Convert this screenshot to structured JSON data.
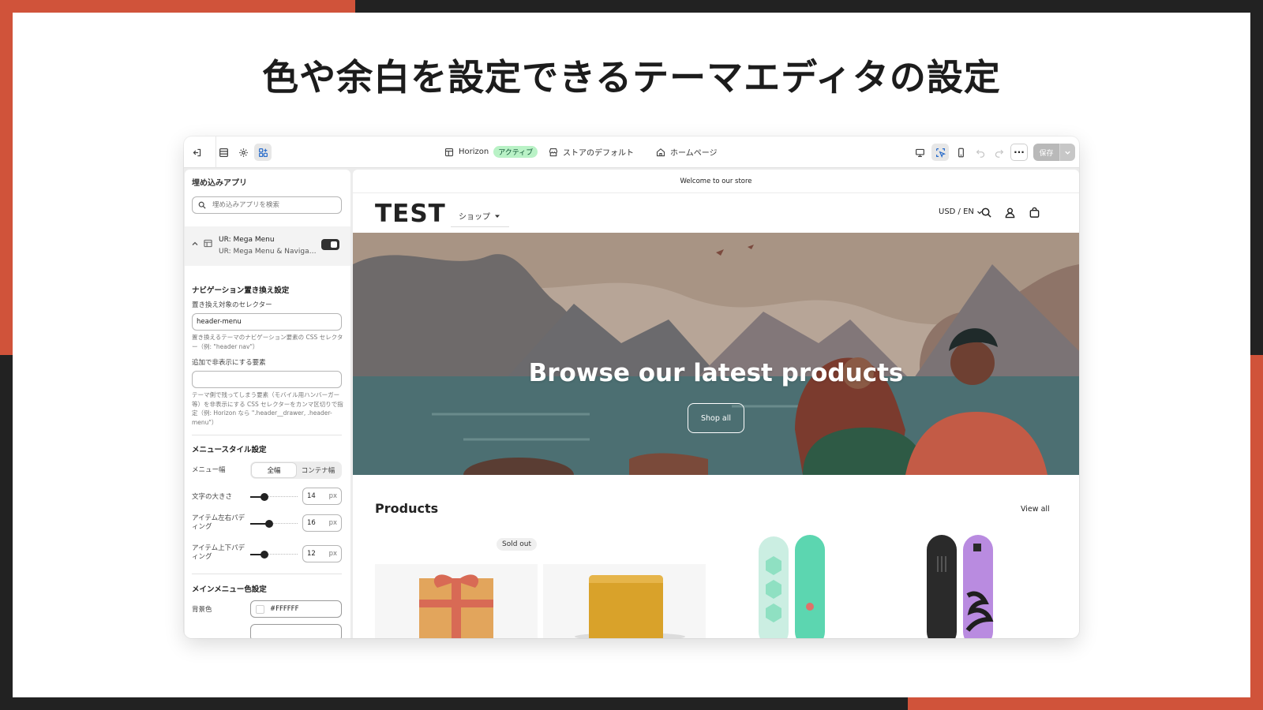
{
  "slide": {
    "headline": "色や余白を設定できるテーマエディタの設定"
  },
  "topbar": {
    "theme_name": "Horizon",
    "theme_badge": "アクティブ",
    "store_default": "ストアのデフォルト",
    "page": "ホームページ",
    "save_label": "保存",
    "icons": [
      "exit-icon",
      "sections-icon",
      "settings-icon",
      "apps-icon",
      "desktop-preview-icon",
      "inspector-icon",
      "mobile-preview-icon",
      "undo-icon",
      "redo-icon",
      "more-icon"
    ]
  },
  "sidebar": {
    "title": "埋め込みアプリ",
    "search_placeholder": "埋め込みアプリを検索",
    "app": {
      "name": "UR: Mega Menu",
      "subtitle": "UR: Mega Menu & Navigat...",
      "enabled": true
    },
    "nav_section": {
      "title": "ナビゲーション置き換え設定",
      "selector_label": "置き換え対象のセレクター",
      "selector_value": "header-menu",
      "selector_help": "置き換えるテーマのナビゲーション要素の CSS セレクター（例: \"header nav\"）",
      "hide_label": "追加で非表示にする要素",
      "hide_value": "",
      "hide_help": "テーマ側で残ってしまう要素（モバイル用ハンバーガー等）を非表示にする CSS セレクターをカンマ区切りで指定（例: Horizon なら \".header__drawer, .header-menu\"）"
    },
    "style_section": {
      "title": "メニュースタイル設定",
      "width_label": "メニュー幅",
      "width_options": [
        "全幅",
        "コンテナ幅"
      ],
      "width_selected": "全幅",
      "font_size_label": "文字の大きさ",
      "font_size_value": "14",
      "font_size_fraction": 0.3,
      "hpad_label": "アイテム左右パディング",
      "hpad_value": "16",
      "hpad_fraction": 0.4,
      "vpad_label": "アイテム上下パディング",
      "vpad_value": "12",
      "vpad_fraction": 0.3,
      "unit": "px"
    },
    "color_section": {
      "title": "メインメニュー色設定",
      "bg_label": "背景色",
      "bg_value": "#FFFFFF"
    }
  },
  "preview": {
    "announcement": "Welcome to our store",
    "logo": "TEST",
    "nav_shop": "ショップ",
    "currency": "USD / EN",
    "hero_title": "Browse our latest products",
    "hero_button": "Shop all",
    "products_title": "Products",
    "view_all": "View all",
    "sold_out": "Sold out"
  },
  "colors": {
    "accent": "#d0533a",
    "dark_frame": "#222222",
    "badge_bg": "#b9f2c6",
    "selected_icon": "#2c6ecb"
  }
}
